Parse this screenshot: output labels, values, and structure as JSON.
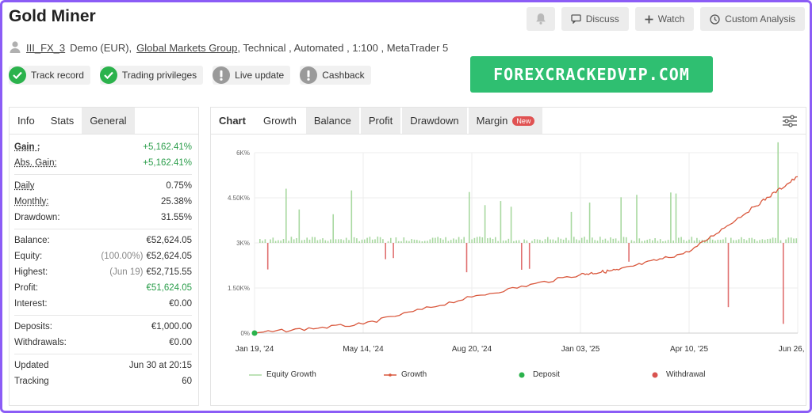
{
  "page": {
    "title": "Gold Miner",
    "user": "III_FX_3",
    "account_type": "Demo (EUR),",
    "broker": "Global Markets Group",
    "details": ", Technical , Automated , 1:100 , MetaTrader 5"
  },
  "header_buttons": {
    "discuss": "Discuss",
    "watch": "Watch",
    "custom": "Custom Analysis"
  },
  "badges": [
    {
      "label": "Track record",
      "status": "verified"
    },
    {
      "label": "Trading privileges",
      "status": "verified"
    },
    {
      "label": "Live update",
      "status": "warning"
    },
    {
      "label": "Cashback",
      "status": "warning"
    }
  ],
  "promo": "FOREXCRACKEDVIP.COM",
  "left_tabs": [
    "Info",
    "Stats",
    "General"
  ],
  "stats": {
    "gain": {
      "label": "Gain :",
      "value": "+5,162.41%"
    },
    "abs_gain": {
      "label": "Abs. Gain:",
      "value": "+5,162.41%"
    },
    "daily": {
      "label": "Daily",
      "value": "0.75%"
    },
    "monthly": {
      "label": "Monthly:",
      "value": "25.38%"
    },
    "drawdown": {
      "label": "Drawdown:",
      "value": "31.55%"
    },
    "balance": {
      "label": "Balance:",
      "value": "€52,624.05"
    },
    "equity": {
      "label": "Equity:",
      "note": "(100.00%)",
      "value": "€52,624.05"
    },
    "highest": {
      "label": "Highest:",
      "note": "(Jun 19)",
      "value": "€52,715.55"
    },
    "profit": {
      "label": "Profit:",
      "value": "€51,624.05"
    },
    "interest": {
      "label": "Interest:",
      "value": "€0.00"
    },
    "deposits": {
      "label": "Deposits:",
      "value": "€1,000.00"
    },
    "withdrawals": {
      "label": "Withdrawals:",
      "value": "€0.00"
    },
    "updated": {
      "label": "Updated",
      "value": "Jun 30 at 20:15"
    },
    "tracking": {
      "label": "Tracking",
      "value": "60"
    }
  },
  "chart_tabs": {
    "chart": "Chart",
    "items": [
      "Growth",
      "Balance",
      "Profit",
      "Drawdown",
      "Margin"
    ],
    "new_badge": "New"
  },
  "colors": {
    "growth": "#d9573c",
    "equity_bar_up": "#a8d8a0",
    "equity_bar_down": "#e07070",
    "deposit": "#2bb24c",
    "withdrawal": "#d9534f",
    "promo": "#2fbf71",
    "frame": "#8b5cf6"
  },
  "chart_data": {
    "type": "line",
    "y_ticks": [
      "6K%",
      "4.50K%",
      "3K%",
      "1.50K%",
      "0%"
    ],
    "x_ticks": [
      "Jan 19, '24",
      "May 14, '24",
      "Aug 20, '24",
      "Jan 03, '25",
      "Apr 10, '25",
      "Jun 26, '25"
    ],
    "ylim": [
      0,
      6000
    ],
    "grid": true,
    "legend_position": "bottom",
    "series": [
      {
        "name": "Growth",
        "x": [
          "Jan 19, '24",
          "May 14, '24",
          "Aug 20, '24",
          "Jan 03, '25",
          "Feb 15, '25",
          "Apr 10, '25",
          "May 20, '25",
          "Jun 26, '25"
        ],
        "values": [
          0,
          300,
          1200,
          1950,
          2100,
          2700,
          4200,
          5200
        ]
      }
    ],
    "legend": [
      {
        "name": "Equity Growth",
        "marker": "line",
        "color": "#a8d8a0"
      },
      {
        "name": "Growth",
        "marker": "line-dot",
        "color": "#d9573c"
      },
      {
        "name": "Deposit",
        "marker": "dot",
        "color": "#2bb24c"
      },
      {
        "name": "Withdrawal",
        "marker": "dot",
        "color": "#d9534f"
      }
    ]
  }
}
